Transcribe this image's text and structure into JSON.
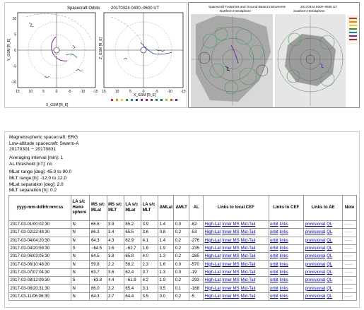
{
  "figure": {
    "orbits": {
      "title": "Spacecraft Orbits",
      "datetime": "20170324 0400−0600 UT",
      "left_xlabel": "X_GSM [R_E]",
      "left_ylabel": "Y_GSM [R_E]",
      "right_xlabel": "X_GSM [R_E]",
      "right_ylabel": "Z_GSM [R_E]",
      "left_xticks": [
        "15",
        "10",
        "5",
        "0",
        "-5",
        "-10",
        "-15"
      ],
      "right_xticks": [
        "15",
        "10",
        "5",
        "0",
        "-5",
        "-10",
        "-15"
      ],
      "yticks": [
        "10",
        "5",
        "0",
        "-5",
        "-10"
      ]
    },
    "footprints": {
      "title": "Spacecraft Footprints and Ground-Based Instruments",
      "datetime": "20170324 0400−0600 UT",
      "left_label": "Northern Hemisphere",
      "right_label": "Southern Hemisphere"
    },
    "colors": {
      "grid": "#b5b5b5",
      "map_fill": "#b0b0b0",
      "orbit_purple": "#7b1fa2",
      "orbit_blue": "#1e3cc8",
      "orbit_green": "#1f8f3a",
      "fov_green": "#37a84a",
      "link": "#0000cc"
    }
  },
  "info": {
    "magnetospheric": "Magnetospheric spacecraft: ERG",
    "low_altitude": "Low-altitude spacecraft: Swarm-A",
    "date_range": "20170301 − 20170831",
    "averaging": "Averaging interval [min]: 1",
    "al_threshold": "AL threshold [nT]: no",
    "mlat_range": "MLat range [deg]: 45.0 to 90.0",
    "mlt_range": "MLT range [h]: -12.0 to 12.0",
    "mlat_sep": "MLat separation [deg]: 2.0",
    "mlt_sep": "MLT separation [h]: 0.2"
  },
  "table": {
    "headers": {
      "datetime": "yyyy-mm-dd/hh:mm:ss",
      "hemisphere": "LA s/c Hemi-sphere",
      "ms_mlat": "MS s/c MLat",
      "ms_mlt": "MS s/c MLT",
      "la_mlat": "LA s/c MLat",
      "la_mlt": "LA s/c MLT",
      "dmlat": "ΔMLat",
      "dmlt": "ΔMLT",
      "al": "AL",
      "cef_local": "Links to local CEF",
      "cef": "Links to CEF",
      "ae": "Links to AE",
      "note": "Note"
    },
    "link_labels": {
      "high_lat": "High-Lat",
      "inner_ms": "Inner MS",
      "mid_tail": "Mid-Tail",
      "orbit": "orbit",
      "links": "links",
      "provisional": "provisional",
      "ql": "QL"
    },
    "note_placeholder": "——",
    "rows": [
      {
        "datetime": "2017-03-01/00:02:30",
        "hemisphere": "N",
        "ms_mlat": "66.6",
        "ms_mlt": "3.9",
        "la_mlat": "65.2",
        "la_mlt": "3.9",
        "dmlat": "1.4",
        "dmlt": "0.0",
        "al": "-62"
      },
      {
        "datetime": "2017-03-02/22:48:30",
        "hemisphere": "N",
        "ms_mlat": "66.3",
        "ms_mlt": "3.4",
        "la_mlat": "65.5",
        "la_mlt": "3.6",
        "dmlat": "0.8",
        "dmlt": "0.2",
        "al": "-53"
      },
      {
        "datetime": "2017-03-04/04:20:30",
        "hemisphere": "N",
        "ms_mlat": "64.3",
        "ms_mlt": "4.3",
        "la_mlat": "62.9",
        "la_mlt": "4.1",
        "dmlat": "1.4",
        "dmlt": "0.2",
        "al": "-276"
      },
      {
        "datetime": "2017-03-04/20:59:30",
        "hemisphere": "S",
        "ms_mlat": "−64.5",
        "ms_mlt": "1.6",
        "la_mlat": "−62.7",
        "la_mlt": "1.6",
        "dmlat": "1.9",
        "dmlt": "0.2",
        "al": "-235"
      },
      {
        "datetime": "2017-03-06/03:05:30",
        "hemisphere": "N",
        "ms_mlat": "64.5",
        "ms_mlt": "3.8",
        "la_mlat": "65.8",
        "la_mlt": "4.0",
        "dmlat": "1.3",
        "dmlt": "0.2",
        "al": "-285"
      },
      {
        "datetime": "2017-03-06/10:48:30",
        "hemisphere": "N",
        "ms_mlat": "59.8",
        "ms_mlt": "2.2",
        "la_mlat": "58.2",
        "la_mlt": "2.3",
        "dmlat": "1.6",
        "dmlt": "0.0",
        "al": "-570"
      },
      {
        "datetime": "2017-03-07/07:04:30",
        "hemisphere": "N",
        "ms_mlat": "63.7",
        "ms_mlt": "3.6",
        "la_mlat": "62.4",
        "la_mlt": "3.7",
        "dmlat": "1.3",
        "dmlt": "0.0",
        "al": "-19"
      },
      {
        "datetime": "2017-03-08/12:09:30",
        "hemisphere": "S",
        "ms_mlat": "−63.8",
        "ms_mlt": "4.4",
        "la_mlat": "−61.9",
        "la_mlt": "4.2",
        "dmlat": "1.9",
        "dmlt": "0.2",
        "al": "-293"
      },
      {
        "datetime": "2017-03-08/20:31:30",
        "hemisphere": "N",
        "ms_mlat": "66.0",
        "ms_mlt": "3.2",
        "la_mlat": "65.4",
        "la_mlt": "3.1",
        "dmlat": "0.5",
        "dmlt": "0.1",
        "al": "-168"
      },
      {
        "datetime": "2017-03-11/06:06:30",
        "hemisphere": "N",
        "ms_mlat": "64.3",
        "ms_mlt": "3.7",
        "la_mlat": "64.4",
        "la_mlt": "3.5",
        "dmlat": "0.0",
        "dmlt": "0.2",
        "al": "-5"
      }
    ]
  }
}
